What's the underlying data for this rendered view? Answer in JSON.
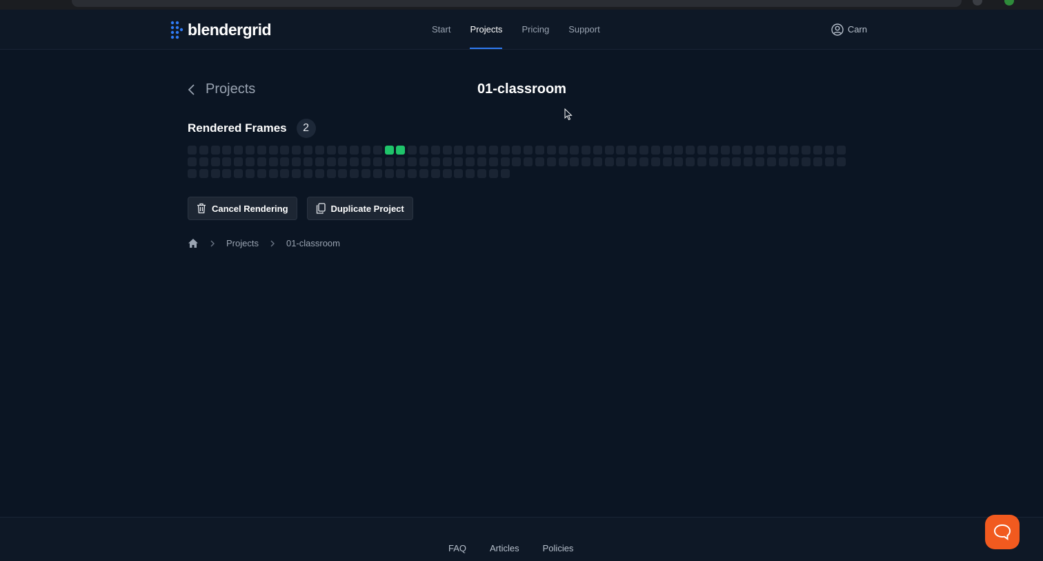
{
  "brand": {
    "name": "blendergrid",
    "accent": "#2f7bf5"
  },
  "nav": {
    "links": [
      {
        "label": "Start",
        "active": false
      },
      {
        "label": "Projects",
        "active": true
      },
      {
        "label": "Pricing",
        "active": false
      },
      {
        "label": "Support",
        "active": false
      }
    ],
    "user_name": "Carn"
  },
  "page": {
    "back_label": "Projects",
    "title": "01-classroom"
  },
  "frames": {
    "title": "Rendered Frames",
    "count": "2",
    "total_frames": 142,
    "done_frames": [
      17,
      18
    ],
    "done_color": "#1fc46a"
  },
  "actions": {
    "cancel_label": "Cancel Rendering",
    "duplicate_label": "Duplicate Project"
  },
  "breadcrumb": {
    "home_icon": "home-icon",
    "items": [
      "Projects",
      "01-classroom"
    ]
  },
  "footer": {
    "links": [
      "FAQ",
      "Articles",
      "Policies"
    ]
  },
  "chat": {
    "icon": "chat-bubble-icon",
    "color": "#f15a1f"
  }
}
